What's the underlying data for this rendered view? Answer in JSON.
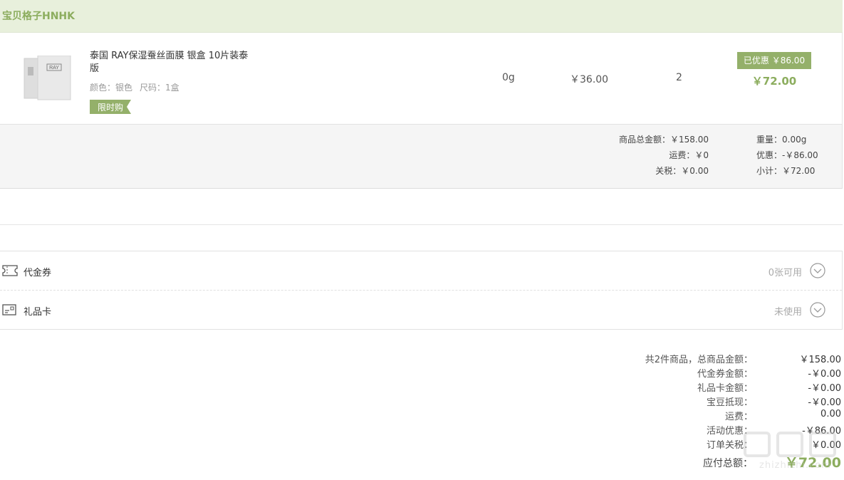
{
  "store": {
    "name": "宝贝格子HNHK"
  },
  "product": {
    "title": "泰国 RAY保湿蚕丝面膜 银盒 10片装泰版",
    "thumb_brand": "RAY",
    "spec_color": "颜色：银色",
    "spec_size": "尺码：1盒",
    "promo_tag": "限时购",
    "weight": "0g",
    "unit_price": "￥36.00",
    "quantity": "2",
    "discount_badge": "已优惠 ￥86.00",
    "line_total": "￥72.00"
  },
  "order_summary": {
    "goods_total": "商品总金额：￥158.00",
    "shipping": "运费：￥0",
    "tax": "关税：￥0.00",
    "weight": "重量：0.00g",
    "discount": "优惠：-￥86.00",
    "subtotal": "小计：￥72.00"
  },
  "benefits": {
    "voucher": {
      "label": "代金券",
      "status": "0张可用",
      "icon": "ticket-icon"
    },
    "gift_card": {
      "label": "礼品卡",
      "status": "未使用",
      "icon": "card-icon"
    }
  },
  "totals": [
    {
      "label": "共2件商品，总商品金额：",
      "value": "￥158.00"
    },
    {
      "label": "代金券金额：",
      "value": "-￥0.00"
    },
    {
      "label": "礼品卡金额：",
      "value": "-￥0.00"
    },
    {
      "label": "宝豆抵现：",
      "value": "-￥0.00"
    },
    {
      "label": "运费：",
      "value": "0.00"
    },
    {
      "label": "活动优惠：",
      "value": "-￥86.00"
    },
    {
      "label": "订单关税：",
      "value": "￥0.00"
    }
  ],
  "grand_total": {
    "label": "应付总额：",
    "value": "￥72.00"
  },
  "watermark": {
    "text": "zhizhizhi.com"
  },
  "colors": {
    "accent": "#8cad5e",
    "header_bg": "#e8f0dc",
    "badge_bg": "#94b06a"
  }
}
